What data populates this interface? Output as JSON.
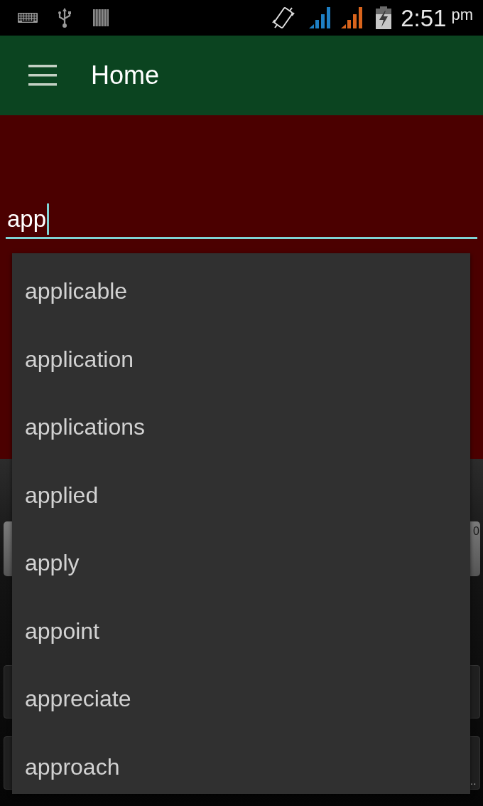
{
  "status_bar": {
    "time": "2:51",
    "time_suffix": "pm"
  },
  "app_bar": {
    "title": "Home"
  },
  "search": {
    "value": "app",
    "focused": true
  },
  "covered_controls": [
    {
      "kind": "button",
      "text": "0"
    },
    {
      "kind": "panel"
    },
    {
      "kind": "panel",
      "text": "…"
    }
  ],
  "suggestions": [
    "applicable",
    "application",
    "applications",
    "applied",
    "apply",
    "appoint",
    "appreciate",
    "approach"
  ]
}
